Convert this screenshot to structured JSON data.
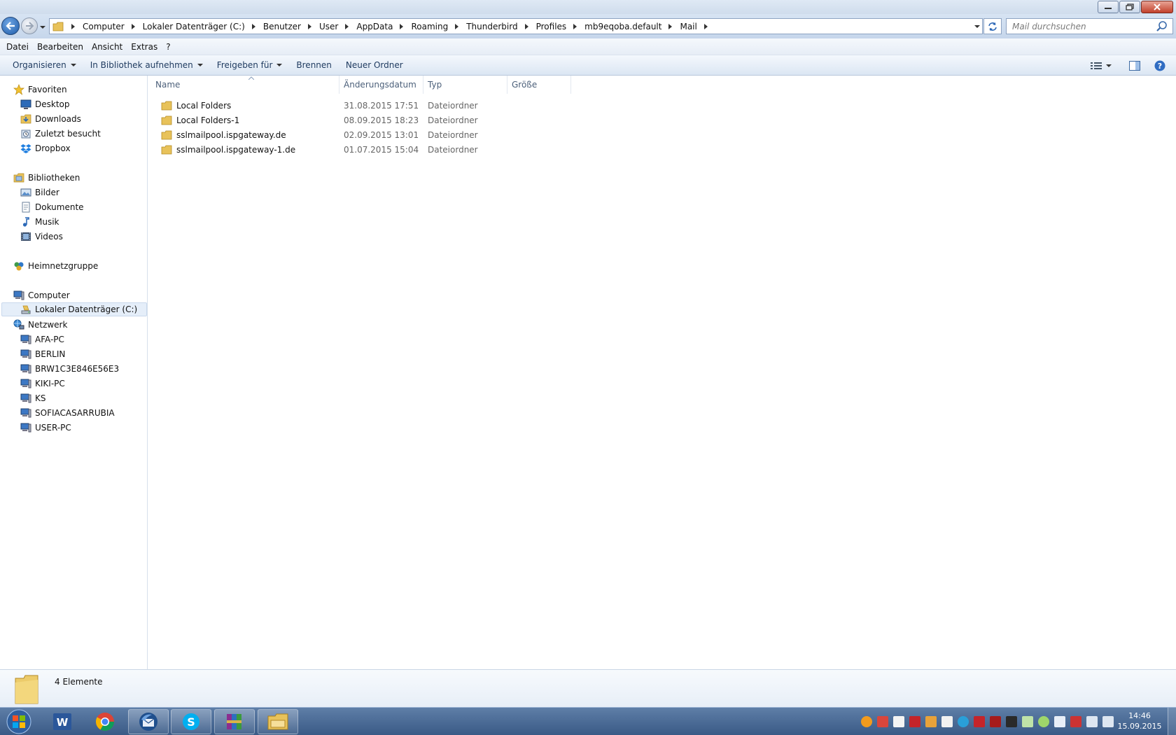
{
  "window": {
    "buttons": {
      "minimize": "minimize-icon",
      "maximize": "restore-icon",
      "close": "close-icon"
    }
  },
  "address_bar": {
    "crumbs": [
      "Computer",
      "Lokaler Datenträger (C:)",
      "Benutzer",
      "User",
      "AppData",
      "Roaming",
      "Thunderbird",
      "Profiles",
      "mb9eqoba.default",
      "Mail"
    ],
    "search_placeholder": "Mail durchsuchen"
  },
  "menubar": {
    "items": [
      "Datei",
      "Bearbeiten",
      "Ansicht",
      "Extras",
      "?"
    ]
  },
  "toolbar": {
    "organize": "Organisieren",
    "include_library": "In Bibliothek aufnehmen",
    "share": "Freigeben für",
    "burn": "Brennen",
    "new_folder": "Neuer Ordner"
  },
  "navpane": {
    "favorites": {
      "label": "Favoriten",
      "items": [
        "Desktop",
        "Downloads",
        "Zuletzt besucht",
        "Dropbox"
      ]
    },
    "libraries": {
      "label": "Bibliotheken",
      "items": [
        "Bilder",
        "Dokumente",
        "Musik",
        "Videos"
      ]
    },
    "homegroup": {
      "label": "Heimnetzgruppe"
    },
    "computer": {
      "label": "Computer",
      "items": [
        "Lokaler Datenträger (C:)"
      ]
    },
    "network": {
      "label": "Netzwerk",
      "items": [
        "AFA-PC",
        "BERLIN",
        "BRW1C3E846E56E3",
        "KIKI-PC",
        "KS",
        "SOFIACASARRUBIA",
        "USER-PC"
      ]
    }
  },
  "filelist": {
    "columns": [
      "Name",
      "Änderungsdatum",
      "Typ",
      "Größe"
    ],
    "rows": [
      {
        "name": "Local Folders",
        "date": "31.08.2015 17:51",
        "type": "Dateiordner",
        "size": ""
      },
      {
        "name": "Local Folders-1",
        "date": "08.09.2015 18:23",
        "type": "Dateiordner",
        "size": ""
      },
      {
        "name": "sslmailpool.ispgateway.de",
        "date": "02.09.2015 13:01",
        "type": "Dateiordner",
        "size": ""
      },
      {
        "name": "sslmailpool.ispgateway-1.de",
        "date": "01.07.2015 15:04",
        "type": "Dateiordner",
        "size": ""
      }
    ]
  },
  "details": {
    "count": "4 Elemente"
  },
  "taskbar": {
    "apps": [
      "word-icon",
      "chrome-icon",
      "thunderbird-icon",
      "skype-icon",
      "winrar-icon",
      "explorer-icon"
    ],
    "clock_time": "14:46",
    "clock_date": "15.09.2015"
  },
  "colors": {
    "accent": "#1d5aa8",
    "selection": "#e5eef9",
    "folder": "#e8c25a"
  }
}
